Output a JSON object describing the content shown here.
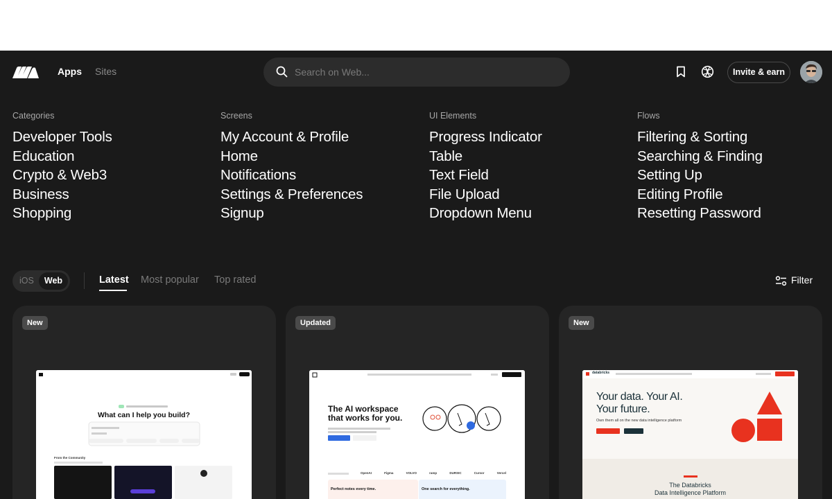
{
  "header": {
    "nav": {
      "apps": "Apps",
      "sites": "Sites"
    },
    "search_placeholder": "Search on Web...",
    "invite_label": "Invite & earn"
  },
  "menu": [
    {
      "heading": "Categories",
      "items": [
        "Developer Tools",
        "Education",
        "Crypto & Web3",
        "Business",
        "Shopping"
      ]
    },
    {
      "heading": "Screens",
      "items": [
        "My Account & Profile",
        "Home",
        "Notifications",
        "Settings & Preferences",
        "Signup"
      ]
    },
    {
      "heading": "UI Elements",
      "items": [
        "Progress Indicator",
        "Table",
        "Text Field",
        "File Upload",
        "Dropdown Menu"
      ]
    },
    {
      "heading": "Flows",
      "items": [
        "Filtering & Sorting",
        "Searching & Finding",
        "Setting Up",
        "Editing Profile",
        "Resetting Password"
      ]
    }
  ],
  "toolbar": {
    "platforms": {
      "ios": "iOS",
      "web": "Web",
      "selected": "Web"
    },
    "tabs": {
      "latest": "Latest",
      "popular": "Most popular",
      "rated": "Top rated"
    },
    "active_tab": "Latest",
    "filter_label": "Filter"
  },
  "cards": [
    {
      "badge": "New",
      "preview": {
        "headline": "What can I help you build?",
        "section": "From the Community"
      }
    },
    {
      "badge": "Updated",
      "preview": {
        "headline_1": "The AI workspace",
        "headline_2": "that works for you.",
        "logos": [
          "OpenAI",
          "Figma",
          "VOLVO",
          "ramp",
          "DURSIC",
          "Cursor",
          "Vercel"
        ],
        "tile_1": "Perfect notes every time.",
        "tile_2": "One search for everything."
      }
    },
    {
      "badge": "New",
      "preview": {
        "brand": "databricks",
        "headline_1": "Your data. Your AI.",
        "headline_2": "Your future.",
        "sub": "Own them all on the new data intelligence platform",
        "section_1": "The Databricks",
        "section_2": "Data Intelligence Platform"
      }
    }
  ],
  "colors": {
    "app_bg": "#1a1a1a",
    "card_bg": "#252525",
    "search_bg": "#2c2c2c",
    "badge_bg": "#4a4a4a",
    "databricks_red": "#e8321f"
  },
  "icons": [
    "logo-icon",
    "search-icon",
    "bookmark-icon",
    "globe-icon",
    "filter-icon"
  ]
}
